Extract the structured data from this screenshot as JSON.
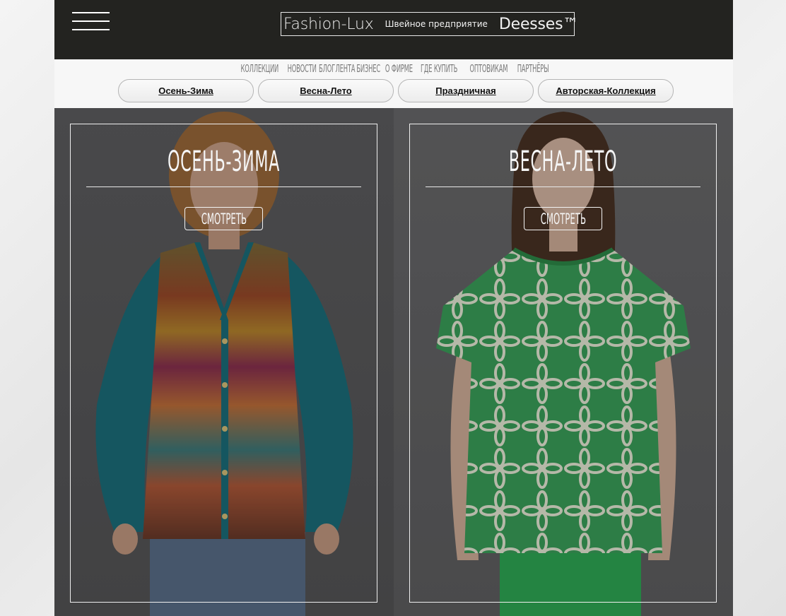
{
  "header": {
    "logo": {
      "main": "Fashion-Lux",
      "sub": "Швейное предприятие",
      "brand": "Deesses™"
    }
  },
  "menu": [
    "Коллекции",
    "Новости",
    "Блог",
    "Лента",
    "Бизнес",
    "О фирме",
    "Где купить",
    "Оптовикам",
    "Партнёры"
  ],
  "pills": [
    "Осень-Зима",
    "Весна-Лето",
    "Праздничная",
    "Авторская-Коллекция"
  ],
  "panels": [
    {
      "title": "Осень-Зима",
      "button": "Смотреть"
    },
    {
      "title": "Весна-Лето",
      "button": "Смотреть"
    }
  ],
  "colors": {
    "header_bg": "#232320",
    "nav_bg": "#f7f7f7",
    "menu_text": "#7a7a7a",
    "cardigan_teal": "#1b6f7c",
    "top_green": "#3aa05a"
  }
}
